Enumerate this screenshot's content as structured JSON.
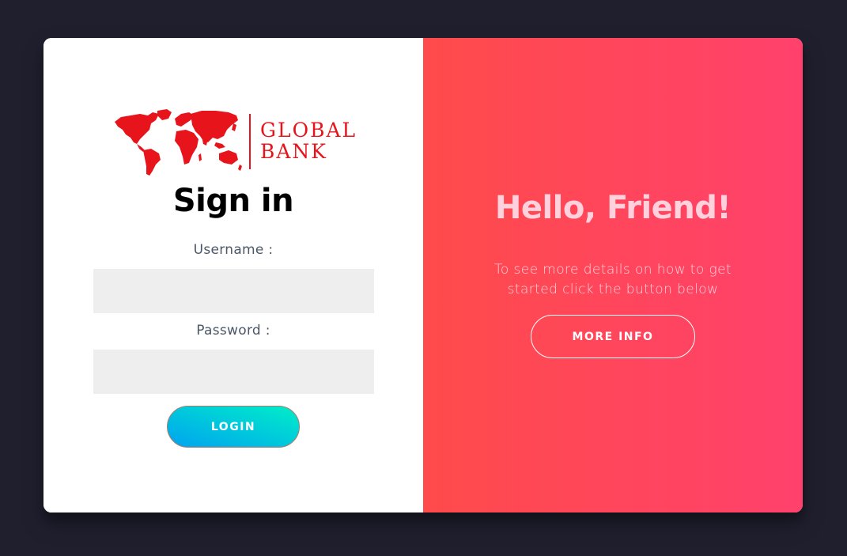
{
  "colors": {
    "page_background": "#1f1f2e",
    "brand_red": "#e8141c",
    "overlay_gradient_start": "#ff4b4b",
    "overlay_gradient_end": "#ff416c",
    "login_gradient_start": "#00a3f0",
    "login_gradient_end": "#00eec8",
    "heading_pink": "#ffd1dc",
    "input_background": "#eeeeee"
  },
  "brand": {
    "logo_icon": "world-map-icon",
    "line1": "GLOBAL",
    "line2": "BANK"
  },
  "signin": {
    "title": "Sign in",
    "username_label": "Username :",
    "username_value": "",
    "password_label": "Password :",
    "password_value": "",
    "login_label": "LOGIN"
  },
  "overlay": {
    "title": "Hello, Friend!",
    "description": "To see more details on how to get started click the button below",
    "button_label": "MORE INFO"
  }
}
